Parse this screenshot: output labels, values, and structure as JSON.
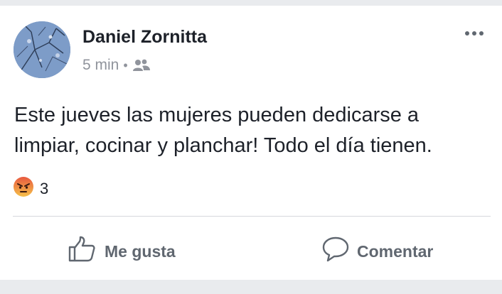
{
  "post": {
    "author": "Daniel Zornitta",
    "time": "5 min",
    "separator": "•",
    "audience_icon": "friends-icon",
    "more_icon": "more-horizontal-icon",
    "text": "Este jueves las mujeres pueden dedicarse a limpiar, cocinar y planchar! Todo el día tienen.",
    "reaction_icon": "angry-reaction-icon",
    "reaction_count": "3"
  },
  "actions": {
    "like_label": "Me gusta",
    "like_icon": "thumbs-up-icon",
    "comment_label": "Comentar",
    "comment_icon": "comment-icon"
  },
  "colors": {
    "text_primary": "#1d2129",
    "text_secondary": "#90949c",
    "action_gray": "#606770",
    "background": "#e9ebee"
  }
}
